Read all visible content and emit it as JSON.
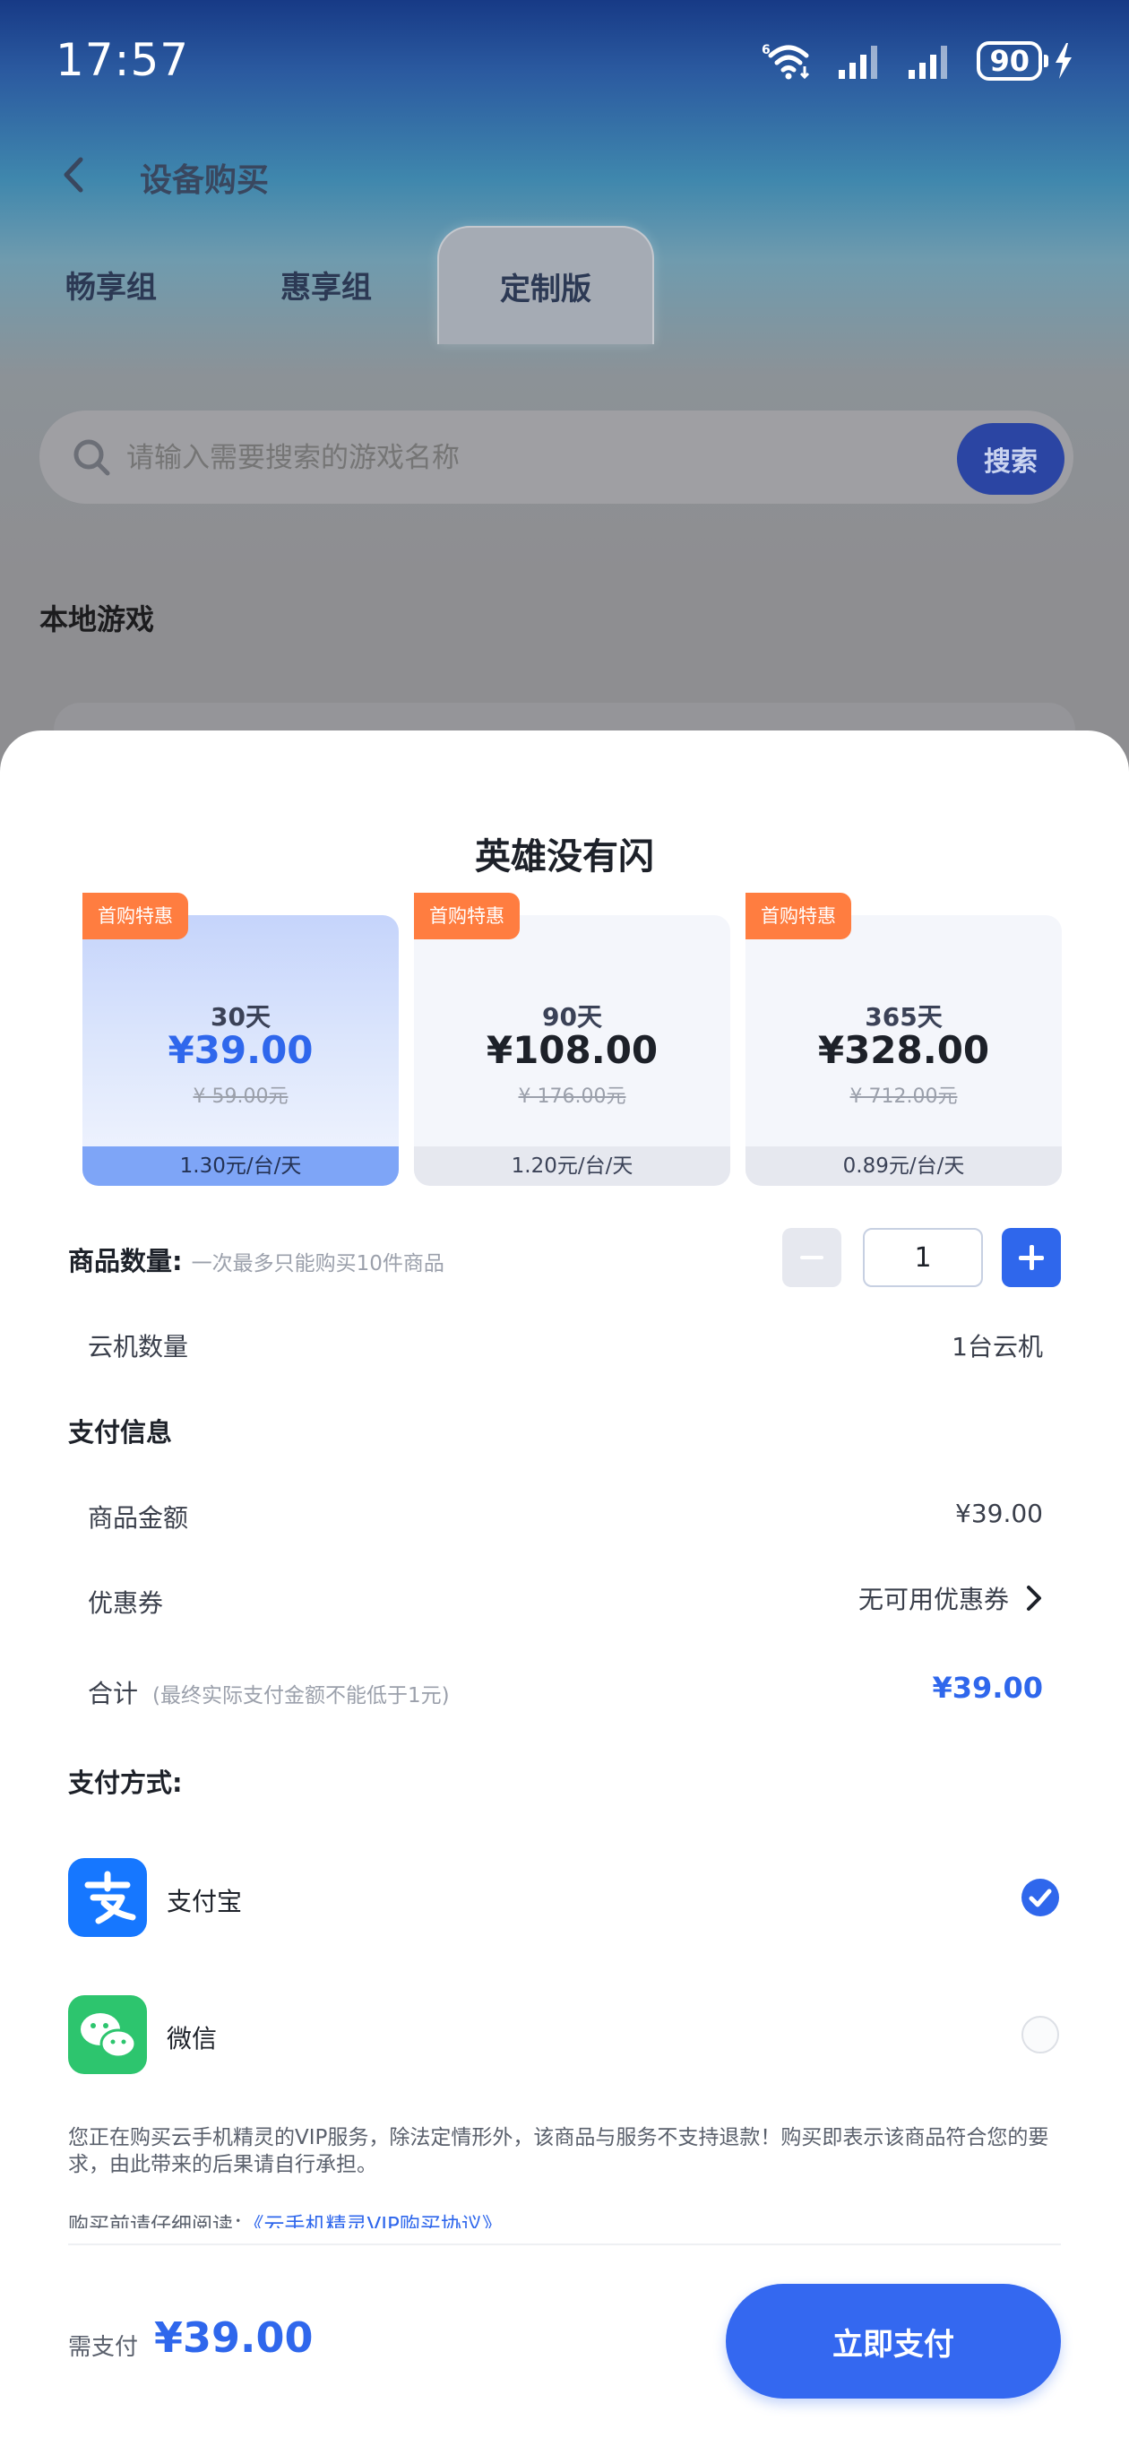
{
  "status_bar": {
    "time": "17:57",
    "battery": "90"
  },
  "nav": {
    "title": "设备购买"
  },
  "tabs": [
    {
      "label": "畅享组"
    },
    {
      "label": "惠享组"
    },
    {
      "label": "定制版"
    }
  ],
  "search": {
    "placeholder": "请输入需要搜索的游戏名称",
    "button": "搜索"
  },
  "local": {
    "title": "本地游戏"
  },
  "sheet": {
    "title": "英雄没有闪",
    "plans": [
      {
        "badge": "首购特惠",
        "days": "30天",
        "price": "¥39.00",
        "original": "¥ 59.00元",
        "unit_price": "1.30元/台/天",
        "selected": true
      },
      {
        "badge": "首购特惠",
        "days": "90天",
        "price": "¥108.00",
        "original": "¥ 176.00元",
        "unit_price": "1.20元/台/天",
        "selected": false
      },
      {
        "badge": "首购特惠",
        "days": "365天",
        "price": "¥328.00",
        "original": "¥ 712.00元",
        "unit_price": "0.89元/台/天",
        "selected": false
      }
    ],
    "quantity": {
      "label": "商品数量:",
      "hint": "一次最多只能购买10件商品",
      "value": "1"
    },
    "cloud_count": {
      "label": "云机数量",
      "value": "1台云机"
    },
    "pay_info": {
      "title": "支付信息",
      "amount_label": "商品金额",
      "amount_value": "¥39.00",
      "coupon_label": "优惠券",
      "coupon_value": "无可用优惠券",
      "total_label": "合计",
      "total_hint": "(最终实际支付金额不能低于1元)",
      "total_value": "¥39.00"
    },
    "pay_method": {
      "title": "支付方式:",
      "options": [
        {
          "label": "支付宝",
          "icon": "alipay-icon",
          "color": "#1677ff",
          "checked": true
        },
        {
          "label": "微信",
          "icon": "wechat-icon",
          "color": "#2dc56e",
          "checked": false
        }
      ]
    },
    "notice": "您正在购买云手机精灵的VIP服务，除法定情形外，该商品与服务不支持退款！购买即表示该商品符合您的要求，由此带来的后果请自行承担。",
    "agreement_prefix": "购买前请仔细阅读：",
    "agreement_link": "《云手机精灵VIP购买协议》"
  },
  "footer": {
    "label": "需支付",
    "amount": "¥39.00",
    "button": "立即支付"
  },
  "colors": {
    "accent": "#2f67ec",
    "badge": "#ff7d40"
  }
}
